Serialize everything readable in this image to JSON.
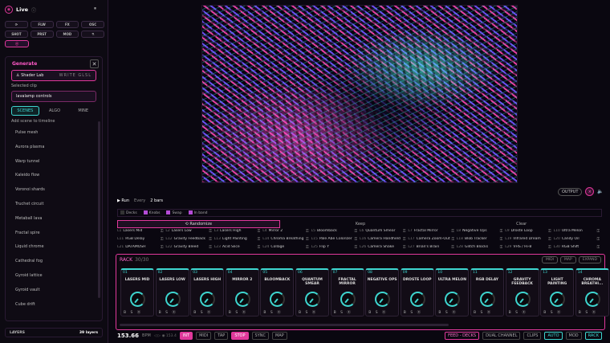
{
  "app": {
    "title": "Live",
    "pause": "⏸"
  },
  "toolbar": {
    "row1": [
      "⟳",
      "FLW",
      "FX",
      "OSC",
      "SHOT",
      "PRST",
      "MOD",
      "⚗"
    ],
    "row3": "⦿"
  },
  "generate": {
    "title": "Generate",
    "close": "✕",
    "source_label": "Shader Lab",
    "source_value": "WRITE GLSL",
    "selected_clip_label": "Selected clip",
    "selected_clip": "lavalamp controls",
    "tabs": [
      "SCENES",
      "ALGO",
      "MINE"
    ],
    "add_hint": "Add scene to timeline"
  },
  "scenes": [
    "Pulse mesh",
    "Aurora plasma",
    "Warp tunnel",
    "Kaleido flow",
    "Voronoi shards",
    "Truchet circuit",
    "Metaball lava",
    "Fractal spire",
    "Liquid chrome",
    "Cathedral fog",
    "Gyroid lattice",
    "Gyroid vault",
    "Cube drift"
  ],
  "layers": {
    "label": "LAYERS",
    "count": "39 layers"
  },
  "output": {
    "label": "OUTPUT",
    "badge": "×",
    "audio": "🔈"
  },
  "run": {
    "run": "▶ Run",
    "every": "Every",
    "bars": "2 bars"
  },
  "options": [
    {
      "label": "Decks",
      "checked": false
    },
    {
      "label": "Knobs",
      "checked": true
    },
    {
      "label": "Swap",
      "checked": true
    },
    {
      "label": "In band",
      "checked": true
    }
  ],
  "actions": [
    "Randomize",
    "Keep",
    "Clear"
  ],
  "library": [
    [
      "L1",
      "Lasers Mid"
    ],
    [
      "L2",
      "Lasers Low"
    ],
    [
      "L3",
      "Lasers High"
    ],
    [
      "L4",
      "Mirror 2"
    ],
    [
      "L5",
      "Bloomback"
    ],
    [
      "L6",
      "Quantum Smear"
    ],
    [
      "L7",
      "Fractal Mirror"
    ],
    [
      "L8",
      "Negative Ops"
    ],
    [
      "L9",
      "Droste Loop"
    ],
    [
      "L10",
      "Ultra Melon"
    ],
    [
      "L11",
      "RGB Delay"
    ],
    [
      "L12",
      "Gravity Feedback"
    ],
    [
      "L13",
      "Light Painting"
    ],
    [
      "L14",
      "Chroma Breathing"
    ],
    [
      "L15",
      "Pale Abe Colorizer"
    ],
    [
      "L16",
      "Camera Handheld"
    ],
    [
      "L17",
      "Camera Zoom-Out"
    ],
    [
      "L18",
      "Blob Tracker"
    ],
    [
      "L19",
      "Infrared Dream"
    ],
    [
      "L20",
      "Candy Oil"
    ],
    [
      "L21",
      "DATAMOSH"
    ],
    [
      "L22",
      "Gravity Bleed"
    ],
    [
      "L23",
      "Acid Slice"
    ],
    [
      "L24",
      "Collage"
    ],
    [
      "L25",
      "Flip Y"
    ],
    [
      "L26",
      "Camera Shake"
    ],
    [
      "L27",
      "Brian's Brain"
    ],
    [
      "L28",
      "Glitch Blocks"
    ],
    [
      "L29",
      "VHS / Hi-8"
    ],
    [
      "L30",
      "RGB Shift"
    ]
  ],
  "rack": {
    "title": "RACK",
    "count": "30/30",
    "buttons": [
      "MIDI",
      "MAP",
      "EXPAND"
    ]
  },
  "decks": [
    [
      "01",
      "LASERS MID"
    ],
    [
      "02",
      "LASERS LOW"
    ],
    [
      "03",
      "LASERS HIGH"
    ],
    [
      "04",
      "MIRROR 2"
    ],
    [
      "05",
      "BLOOMBACK"
    ],
    [
      "06",
      "QUANTUM SMEAR"
    ],
    [
      "07",
      "FRACTAL MIRROR"
    ],
    [
      "08",
      "NEGATIVE OPS"
    ],
    [
      "09",
      "DROSTE LOOP"
    ],
    [
      "10",
      "ULTRA MELON"
    ],
    [
      "11",
      "RGB DELAY"
    ],
    [
      "12",
      "GRAVITY FEEDBACK"
    ],
    [
      "13",
      "LIGHT PAINTING"
    ],
    [
      "14",
      "CHROMA BREATHI..."
    ]
  ],
  "deck_ctrl": "B S ⦿",
  "transport": {
    "bpm": "153.66",
    "bpm_unit": "BPM",
    "small": "◁ ▷ ◉ 153.4",
    "buttons": [
      "INT",
      "MIDI",
      "TAP",
      "STOP",
      "SYNC",
      "MAP"
    ],
    "right": [
      "FEED - DECKS",
      "DUAL CHANNEL",
      "CLIPS",
      "AUTO",
      "MOD",
      "RACK"
    ]
  }
}
